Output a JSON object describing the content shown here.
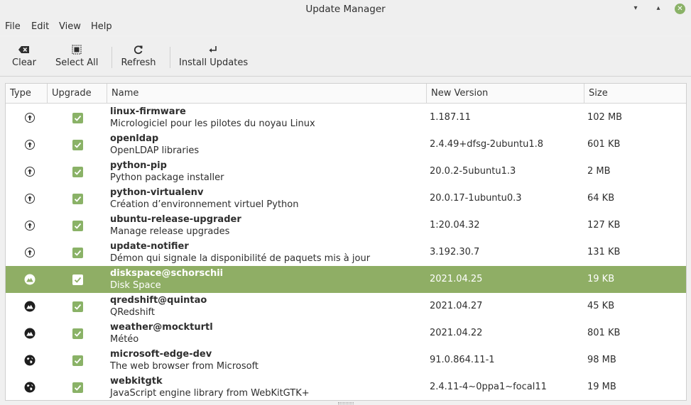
{
  "window": {
    "title": "Update Manager"
  },
  "menu": [
    "File",
    "Edit",
    "View",
    "Help"
  ],
  "toolbar": {
    "clear": "Clear",
    "select_all": "Select All",
    "refresh": "Refresh",
    "install": "Install Updates"
  },
  "columns": [
    "Type",
    "Upgrade",
    "Name",
    "New Version",
    "Size"
  ],
  "packages": [
    {
      "type": "package-icon",
      "checked": true,
      "name": "linux-firmware",
      "desc": "Micrologiciel pour les pilotes du noyau Linux",
      "version": "1.187.11",
      "size": "102 MB",
      "selected": false
    },
    {
      "type": "package-icon",
      "checked": true,
      "name": "openldap",
      "desc": "OpenLDAP libraries",
      "version": "2.4.49+dfsg-2ubuntu1.8",
      "size": "601 KB",
      "selected": false
    },
    {
      "type": "package-icon",
      "checked": true,
      "name": "python-pip",
      "desc": "Python package installer",
      "version": "20.0.2-5ubuntu1.3",
      "size": "2 MB",
      "selected": false
    },
    {
      "type": "package-icon",
      "checked": true,
      "name": "python-virtualenv",
      "desc": "Création d’environnement virtuel Python",
      "version": "20.0.17-1ubuntu0.3",
      "size": "64 KB",
      "selected": false
    },
    {
      "type": "package-icon",
      "checked": true,
      "name": "ubuntu-release-upgrader",
      "desc": "Manage release upgrades",
      "version": "1:20.04.32",
      "size": "127 KB",
      "selected": false
    },
    {
      "type": "package-icon",
      "checked": true,
      "name": "update-notifier",
      "desc": "Démon qui signale la disponibilité de paquets mis à jour",
      "version": "3.192.30.7",
      "size": "131 KB",
      "selected": false
    },
    {
      "type": "cinnamon-icon",
      "checked": true,
      "name": "diskspace@schorschii",
      "desc": "Disk Space",
      "version": "2021.04.25",
      "size": "19 KB",
      "selected": true
    },
    {
      "type": "cinnamon-icon",
      "checked": true,
      "name": "qredshift@quintao",
      "desc": "QRedshift",
      "version": "2021.04.27",
      "size": "45 KB",
      "selected": false
    },
    {
      "type": "cinnamon-icon",
      "checked": true,
      "name": "weather@mockturtl",
      "desc": "Météo",
      "version": "2021.04.22",
      "size": "801 KB",
      "selected": false
    },
    {
      "type": "globe-icon",
      "checked": true,
      "name": "microsoft-edge-dev",
      "desc": "The web browser from Microsoft",
      "version": "91.0.864.11-1",
      "size": "98 MB",
      "selected": false
    },
    {
      "type": "globe-icon",
      "checked": true,
      "name": "webkitgtk",
      "desc": "JavaScript engine library from WebKitGTK+",
      "version": "2.4.11-4~0ppa1~focal11",
      "size": "19 MB",
      "selected": false
    }
  ],
  "colors": {
    "accent": "#8fae65",
    "check": "#8ab267"
  }
}
